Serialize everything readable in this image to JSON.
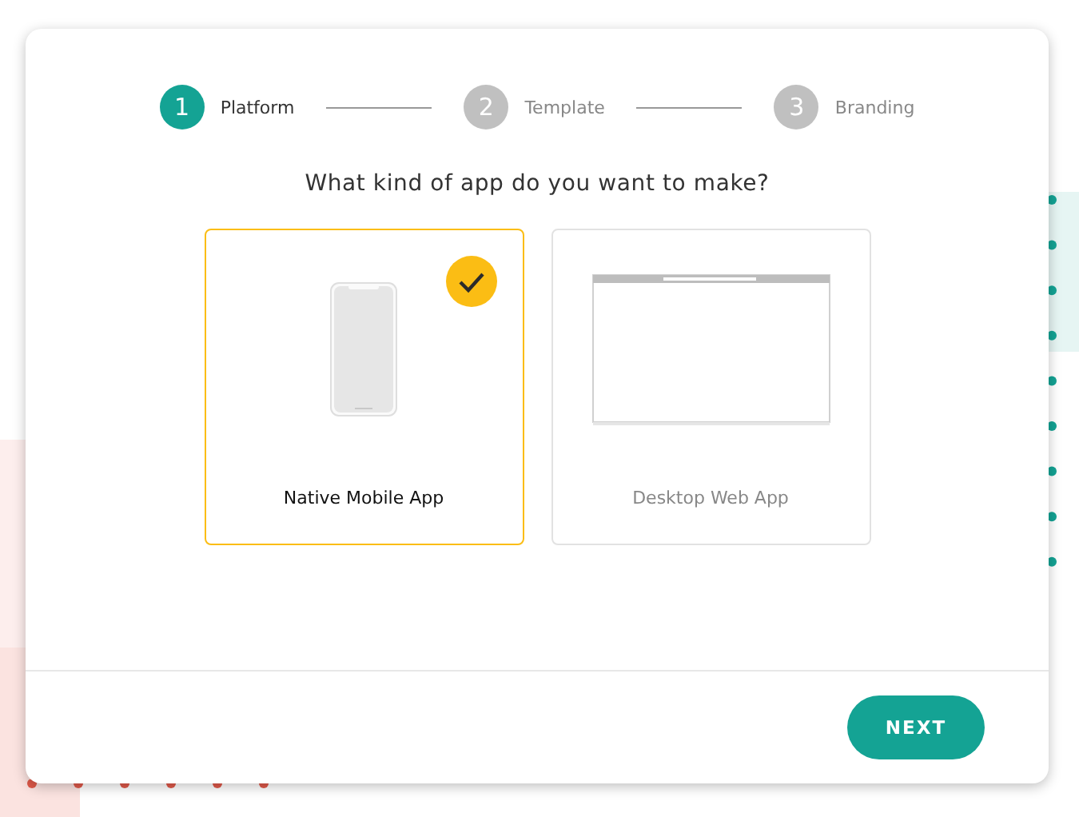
{
  "steps": [
    {
      "number": "1",
      "label": "Platform",
      "selected": true
    },
    {
      "number": "2",
      "label": "Template",
      "selected": false
    },
    {
      "number": "3",
      "label": "Branding",
      "selected": false
    }
  ],
  "question": "What kind of app do you want to make?",
  "options": [
    {
      "kind": "mobile",
      "label": "Native Mobile App",
      "selected": true
    },
    {
      "kind": "desktop",
      "label": "Desktop Web App",
      "selected": false
    }
  ],
  "next_button": "NEXT"
}
